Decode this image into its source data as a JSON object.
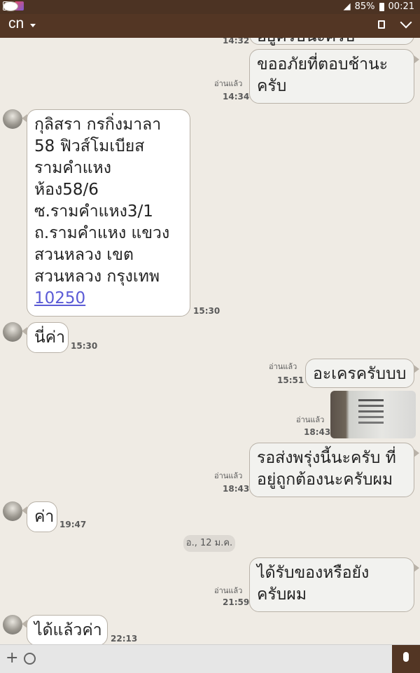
{
  "status_bar": {
    "battery": "85%",
    "time": "00:21"
  },
  "app_bar": {
    "title": "cn"
  },
  "messages": [
    {
      "type": "sent",
      "read": "อ่านแล้ว",
      "time": "14:32",
      "lines": [
        "อยู่ครับนะครับ"
      ]
    },
    {
      "type": "sent",
      "read": "อ่านแล้ว",
      "time": "14:34",
      "lines": [
        "ขออภัยที่ตอบช้านะ",
        "ครับ"
      ]
    },
    {
      "type": "received",
      "time": "15:30",
      "lines": [
        "กุลิสรา กรกิ่งมาลา",
        "58 ฟิวส์โมเบียส",
        "รามคำแหง",
        "ห้อง58/6",
        "ซ.รามคำแหง3/1",
        "ถ.รามคำแหง แขวง",
        "สวนหลวง เขต",
        "สวนหลวง กรุงเทพ"
      ],
      "link": "10250"
    },
    {
      "type": "received",
      "time": "15:30",
      "lines": [
        "นี่ค่า"
      ]
    },
    {
      "type": "sent",
      "read": "อ่านแล้ว",
      "time": "15:51",
      "lines": [
        "อะเครครับบบ"
      ]
    },
    {
      "type": "sent_photo",
      "read": "อ่านแล้ว",
      "time": "18:43"
    },
    {
      "type": "sent",
      "read": "อ่านแล้ว",
      "time": "18:43",
      "lines": [
        "รอส่งพรุ่งนี้นะครับ ที่",
        "อยู่ถูกต้องนะครับผม"
      ]
    },
    {
      "type": "received",
      "time": "19:47",
      "lines": [
        "ค่า"
      ]
    },
    {
      "type": "date",
      "label": "อ., 12 ม.ค."
    },
    {
      "type": "sent",
      "read": "อ่านแล้ว",
      "time": "21:59",
      "lines": [
        "ได้รับของหรือยัง",
        "ครับผม"
      ]
    },
    {
      "type": "received",
      "time": "22:13",
      "lines": [
        "ได้แล้วค่า"
      ]
    }
  ]
}
